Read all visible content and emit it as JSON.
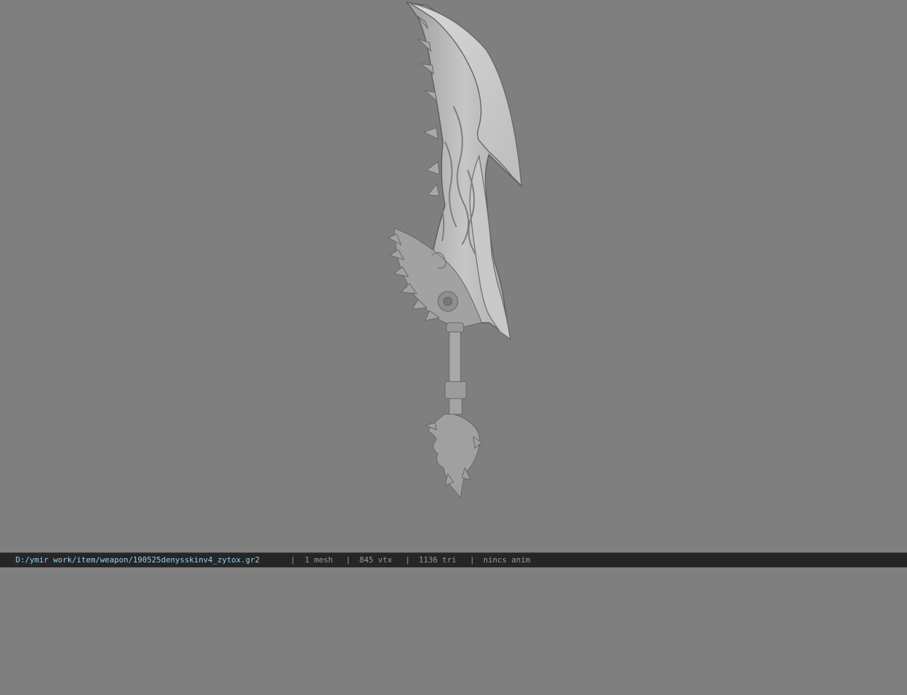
{
  "viewport": {
    "background_color": "#7f7f7f",
    "model_color": "#b4b4b4",
    "model": "curved-sword-weapon"
  },
  "statusbar": {
    "path": "D:/ymir work/item/weapon/190525denysskinv4_zytox.gr2",
    "separator": "|",
    "mesh": "1 mesh",
    "vertices": "845 vtx",
    "triangles": "1136 tri",
    "anim": "nincs anim",
    "path_color": "#8fd3f3",
    "text_color": "#9a9a9a"
  }
}
